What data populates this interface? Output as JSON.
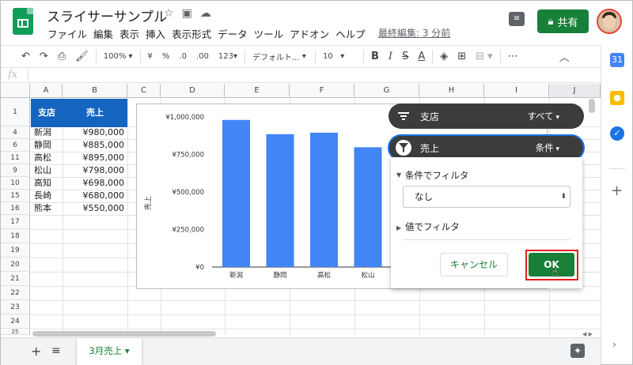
{
  "header": {
    "doc_title": "スライサーサンプル",
    "title_icons": [
      "☆",
      "▣",
      "☁"
    ],
    "menu": [
      "ファイル",
      "編集",
      "表示",
      "挿入",
      "表示形式",
      "データ",
      "ツール",
      "アドオン",
      "ヘルプ"
    ],
    "last_edit": "最終編集: 3 分前",
    "share_label": "共有"
  },
  "toolbar": {
    "zoom": "100%",
    "currency": "¥",
    "percent": "%",
    "dec_less": ".0",
    "dec_more": ".00",
    "format_more": "123",
    "font": "デフォルト...",
    "font_size": "10",
    "bold": "B",
    "italic": "I",
    "strike": "S",
    "text_color": "A",
    "more": "⋯"
  },
  "formula_bar": {
    "fx": "fx"
  },
  "columns": [
    "A",
    "B",
    "C",
    "D",
    "E",
    "F",
    "G",
    "H",
    "I",
    "J"
  ],
  "rows": [
    "1",
    "4",
    "6",
    "11",
    "9",
    "10",
    "15",
    "16",
    "17",
    "18",
    "19",
    "20",
    "21",
    "22",
    "23",
    "24",
    "25"
  ],
  "table": {
    "header": [
      "支店",
      "売上"
    ],
    "data": [
      [
        "新潟",
        "¥980,000"
      ],
      [
        "静岡",
        "¥885,000"
      ],
      [
        "高松",
        "¥895,000"
      ],
      [
        "松山",
        "¥798,000"
      ],
      [
        "高知",
        "¥698,000"
      ],
      [
        "長崎",
        "¥680,000"
      ],
      [
        "熊本",
        "¥550,000"
      ]
    ]
  },
  "chart_data": {
    "type": "bar",
    "ylabel": "売上",
    "categories": [
      "新潟",
      "静岡",
      "高松",
      "松山"
    ],
    "values": [
      980000,
      885000,
      895000,
      798000
    ],
    "ylim": [
      0,
      1000000
    ],
    "yticks": [
      "¥1,000,000",
      "¥750,000",
      "¥500,000",
      "¥250,000",
      "¥0"
    ],
    "color": "#4285f4"
  },
  "slicers": [
    {
      "label": "支店",
      "value": "すべて"
    },
    {
      "label": "売上",
      "value": "条件"
    }
  ],
  "filter_panel": {
    "by_condition": "条件でフィルタ",
    "condition_value": "なし",
    "by_values": "値でフィルタ",
    "cancel": "キャンセル",
    "ok": "OK"
  },
  "bottom": {
    "add": "+",
    "all": "≡",
    "sheet_tab": "3月売上 ▾"
  },
  "colors": {
    "accent_green": "#188038",
    "header_blue": "#1565c0",
    "highlight_red": "#e0201b"
  }
}
